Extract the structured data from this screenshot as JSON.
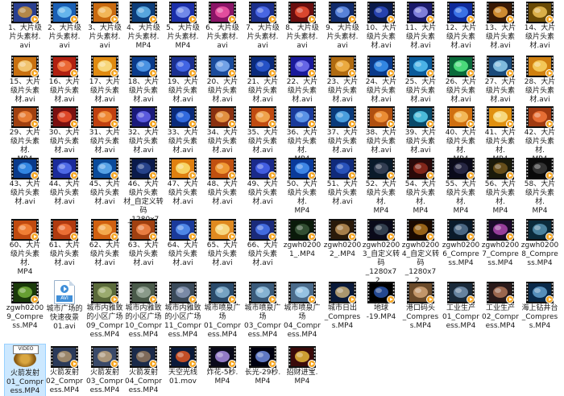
{
  "explorer": {
    "items": [
      {
        "label": "1、大片级\n片头素材.\navi",
        "thumb": "#2a3f8f",
        "thumb2": "#e0a030",
        "icon": "video-thumb-icon"
      },
      {
        "label": "2、大片级\n片头素材.\navi",
        "thumb": "#1a5fb4",
        "thumb2": "#7fd0ff",
        "icon": "video-thumb-icon"
      },
      {
        "label": "3、大片级\n片头素材.\navi",
        "thumb": "#c96a10",
        "thumb2": "#ffd070",
        "icon": "video-thumb-icon"
      },
      {
        "label": "4、大片级\n片头素材.\nMP4",
        "thumb": "#0c3d7a",
        "thumb2": "#70c8ff",
        "icon": "video-thumb-icon"
      },
      {
        "label": "5、大片级\n片头素材.\nMP4",
        "thumb": "#1b2fa8",
        "thumb2": "#8fa8ff",
        "icon": "video-thumb-icon"
      },
      {
        "label": "6、大片级\n片头素材.\navi",
        "thumb": "#8a1466",
        "thumb2": "#ff60b0",
        "icon": "video-thumb-icon"
      },
      {
        "label": "7、大片级\n片头素材.\navi",
        "thumb": "#1a2e8a",
        "thumb2": "#5a7aff",
        "icon": "video-thumb-icon"
      },
      {
        "label": "8、大片级\n片头素材.\navi",
        "thumb": "#6a0e0e",
        "thumb2": "#ff5a3a",
        "icon": "video-thumb-icon"
      },
      {
        "label": "9、大片级\n片头素材.\navi",
        "thumb": "#102a6a",
        "thumb2": "#70a0ff",
        "icon": "video-thumb-icon"
      },
      {
        "label": "10、大片\n级片头素\n材.avi",
        "thumb": "#0a1a4a",
        "thumb2": "#3050d0",
        "icon": "video-thumb-icon"
      },
      {
        "label": "11、大片\n级片头素\n材.avi",
        "thumb": "#1a1a6a",
        "thumb2": "#a0a0ff",
        "icon": "video-thumb-icon"
      },
      {
        "label": "12、大片\n级片头素\n材.avi",
        "thumb": "#0e2a9a",
        "thumb2": "#4a8aff",
        "icon": "video-thumb-icon"
      },
      {
        "label": "13、大片\n级片头素\n材.avi",
        "thumb": "#3a1a05",
        "thumb2": "#ffb040",
        "icon": "video-thumb-icon"
      },
      {
        "label": "14、大片\n级片头素\n材.avi",
        "thumb": "#6a4a05",
        "thumb2": "#ffd060",
        "icon": "video-thumb-icon"
      },
      {
        "label": "15、大片\n级片头素\n材.avi",
        "thumb": "#c87010",
        "thumb2": "#ffe090",
        "icon": "video-thumb-icon"
      },
      {
        "label": "16、大片\n级片头素\n材.avi",
        "thumb": "#b02010",
        "thumb2": "#ff8040",
        "icon": "video-thumb-icon"
      },
      {
        "label": "17、大片\n级片头素\n材.avi",
        "thumb": "#e08a10",
        "thumb2": "#fff0a0",
        "icon": "video-thumb-icon"
      },
      {
        "label": "18、大片\n级片头素\n材.avi",
        "thumb": "#0a3a8a",
        "thumb2": "#60b0ff",
        "icon": "video-thumb-icon"
      },
      {
        "label": "19、大片\n级片头素\n材.avi",
        "thumb": "#1a2f8f",
        "thumb2": "#5078ff",
        "icon": "video-thumb-icon"
      },
      {
        "label": "20、大片\n级片头素\n材.avi",
        "thumb": "#1a4a9a",
        "thumb2": "#90c0ff",
        "icon": "video-thumb-icon"
      },
      {
        "label": "21、大片\n级片头素\n材.avi",
        "thumb": "#0a2a7a",
        "thumb2": "#3060e0",
        "icon": "video-thumb-icon"
      },
      {
        "label": "22、大片\n级片头素\n材.avi",
        "thumb": "#1a1a9a",
        "thumb2": "#8080ff",
        "icon": "video-thumb-icon"
      },
      {
        "label": "23、大片\n级片头素\n材.avi",
        "thumb": "#b06a10",
        "thumb2": "#ffc050",
        "icon": "video-thumb-icon"
      },
      {
        "label": "24、大片\n级片头素\n材.avi",
        "thumb": "#0a3a8a",
        "thumb2": "#40a0ff",
        "icon": "video-thumb-icon"
      },
      {
        "label": "25、大片\n级片头素\n材.avi",
        "thumb": "#0a5a9a",
        "thumb2": "#60d0ff",
        "icon": "video-thumb-icon"
      },
      {
        "label": "26、大片\n级片头素\n材.avi",
        "thumb": "#0a6a3a",
        "thumb2": "#60ff90",
        "icon": "video-thumb-icon"
      },
      {
        "label": "27、大片\n级片头素\n材.avi",
        "thumb": "#1a4a7a",
        "thumb2": "#a0e0ff",
        "icon": "video-thumb-icon"
      },
      {
        "label": "28、大片\n级片头素\n材.avi",
        "thumb": "#d08010",
        "thumb2": "#ffe070",
        "icon": "video-thumb-icon"
      },
      {
        "label": "29、大片\n级片头素\n材.\nMP4",
        "thumb": "#a04010",
        "thumb2": "#ff9040",
        "icon": "video-thumb-icon"
      },
      {
        "label": "30、大片\n级片头素\n材.avi",
        "thumb": "#7a1010",
        "thumb2": "#ff5a30",
        "icon": "video-thumb-icon"
      },
      {
        "label": "31、大片\n级片头素\n材.avi",
        "thumb": "#c04010",
        "thumb2": "#ffa040",
        "icon": "video-thumb-icon"
      },
      {
        "label": "32、大片\n级片头素\n材.avi",
        "thumb": "#1a1a7a",
        "thumb2": "#7070ff",
        "icon": "video-thumb-icon"
      },
      {
        "label": "33、大片\n级片头素\n材.avi",
        "thumb": "#0a2a7a",
        "thumb2": "#4080ff",
        "icon": "video-thumb-icon"
      },
      {
        "label": "34、大片\n级片头素\n材.avi",
        "thumb": "#8a3010",
        "thumb2": "#ffb050",
        "icon": "video-thumb-icon"
      },
      {
        "label": "35、大片\n级片头素\n材.avi",
        "thumb": "#c04a10",
        "thumb2": "#ffc060",
        "icon": "video-thumb-icon"
      },
      {
        "label": "36、大片\n级片头素\n材.\nMP4",
        "thumb": "#1a3a9a",
        "thumb2": "#70b0ff",
        "icon": "video-thumb-icon"
      },
      {
        "label": "37、大片\n级片头素\n材.avi",
        "thumb": "#0a3a7a",
        "thumb2": "#60c0ff",
        "icon": "video-thumb-icon"
      },
      {
        "label": "38、大片\n级片头素\n材.avi",
        "thumb": "#b05010",
        "thumb2": "#ffa040",
        "icon": "video-thumb-icon"
      },
      {
        "label": "39、大片\n级片头素\n材.avi",
        "thumb": "#0a4a6a",
        "thumb2": "#60e0ff",
        "icon": "video-thumb-icon"
      },
      {
        "label": "40、大片\n级片头素\n材.\nMP4",
        "thumb": "#d07010",
        "thumb2": "#ffd070",
        "icon": "video-thumb-icon"
      },
      {
        "label": "41、大片\n级片头素\n材.\nMP4",
        "thumb": "#e09010",
        "thumb2": "#fff0a0",
        "icon": "video-thumb-icon"
      },
      {
        "label": "42、大片\n级片头素\n材.\nMP4",
        "thumb": "#a03a10",
        "thumb2": "#ff8040",
        "icon": "video-thumb-icon"
      },
      {
        "label": "43、大片\n级片头素\n材.avi",
        "thumb": "#0a3a8a",
        "thumb2": "#40a0ff",
        "icon": "video-thumb-icon"
      },
      {
        "label": "44、大片\n级片头素\n材.avi",
        "thumb": "#1a2a9a",
        "thumb2": "#6080ff",
        "icon": "video-thumb-icon"
      },
      {
        "label": "45、大片\n级片头素\n材.avi",
        "thumb": "#0a4a9a",
        "thumb2": "#70c0ff",
        "icon": "video-thumb-icon"
      },
      {
        "label": "46、大片\n级片头素\n材_自定义转码\n_1280x72...",
        "thumb": "#0a1a4a",
        "thumb2": "#3050a0",
        "icon": "video-thumb-icon"
      },
      {
        "label": "47、大片\n级片头素\n材.avi",
        "thumb": "#e08010",
        "thumb2": "#fff080",
        "icon": "video-thumb-icon"
      },
      {
        "label": "48、大片\n级片头素\n材.avi",
        "thumb": "#c05010",
        "thumb2": "#ffb040",
        "icon": "video-thumb-icon"
      },
      {
        "label": "49、大片\n级片头素\n材.avi",
        "thumb": "#1a2a8a",
        "thumb2": "#5070ff",
        "icon": "video-thumb-icon"
      },
      {
        "label": "50、大片\n级片头素\n材.\nMP4",
        "thumb": "#0a3a9a",
        "thumb2": "#50a0ff",
        "icon": "video-thumb-icon"
      },
      {
        "label": "51、大片\n级片头素\n材.avi",
        "thumb": "#102a7a",
        "thumb2": "#3060d0",
        "icon": "video-thumb-icon"
      },
      {
        "label": "52、大片\n级片头素\n材.\nMP4",
        "thumb": "#0a1a2a",
        "thumb2": "#404a60",
        "icon": "video-thumb-icon"
      },
      {
        "label": "54、大片\n级片头素\n材.\nMP4",
        "thumb": "#2a0a0a",
        "thumb2": "#a03020",
        "icon": "video-thumb-icon"
      },
      {
        "label": "55、大片\n级片头素\n材.\nMP4",
        "thumb": "#0a0a1a",
        "thumb2": "#303050",
        "icon": "video-thumb-icon"
      },
      {
        "label": "56、大片\n级片头素\n材.\nMP4",
        "thumb": "#1a1a0a",
        "thumb2": "#806020",
        "icon": "video-thumb-icon"
      },
      {
        "label": "58、大片\n级片头素\n材.\nMP4",
        "thumb": "#0a0a0a",
        "thumb2": "#404040",
        "icon": "video-thumb-icon"
      },
      {
        "label": "60、大片\n级片头素\n材.\nMP4",
        "thumb": "#c04a10",
        "thumb2": "#ff9040",
        "icon": "video-thumb-icon"
      },
      {
        "label": "61、大片\n级片头素\n材.avi",
        "thumb": "#b03a10",
        "thumb2": "#ff8040",
        "icon": "video-thumb-icon"
      },
      {
        "label": "62、大片\n级片头素\n材.avi",
        "thumb": "#d06010",
        "thumb2": "#ffc060",
        "icon": "video-thumb-icon"
      },
      {
        "label": "63、大片\n级片头素\n材.avi",
        "thumb": "#a04010",
        "thumb2": "#ff9050",
        "icon": "video-thumb-icon"
      },
      {
        "label": "64、大片\n级片头素\n材.avi",
        "thumb": "#1a3a9a",
        "thumb2": "#60a0ff",
        "icon": "video-thumb-icon"
      },
      {
        "label": "65、大片\n级片头素\n材.avi",
        "thumb": "#e08a20",
        "thumb2": "#fff0a0",
        "icon": "video-thumb-icon"
      },
      {
        "label": "66、大片\n级片头素\n材.avi",
        "thumb": "#1a2a7a",
        "thumb2": "#5080ff",
        "icon": "video-thumb-icon"
      },
      {
        "label": "zgwh0200\n1_.MP4",
        "thumb": "#0a1a0a",
        "thumb2": "#406040",
        "icon": "video-thumb-icon"
      },
      {
        "label": "zgwh0200\n2_.MP4",
        "thumb": "#2a1a0a",
        "thumb2": "#d0a060",
        "icon": "video-thumb-icon"
      },
      {
        "label": "zgwh0200\n3_自定义转\n码\n_1280x72...",
        "thumb": "#0a0a1a",
        "thumb2": "#405060",
        "icon": "video-thumb-icon"
      },
      {
        "label": "zgwh0200\n4_自定义转\n码\n_1280x72...",
        "thumb": "#1a0a00",
        "thumb2": "#c08020",
        "icon": "video-thumb-icon"
      },
      {
        "label": "zgwh0200\n6_Compre\nss.MP4",
        "thumb": "#0a1a2a",
        "thumb2": "#6080a0",
        "icon": "video-thumb-icon"
      },
      {
        "label": "zgwh0200\n7_Compre\nss.MP4",
        "thumb": "#1a0a2a",
        "thumb2": "#c050c0",
        "icon": "video-thumb-icon"
      },
      {
        "label": "zgwh0200\n8_Compre\nss.MP4",
        "thumb": "#0a2a3a",
        "thumb2": "#60a0c0",
        "icon": "video-thumb-icon"
      },
      {
        "label": "zgwh0200\n9_Compre\nss.MP4",
        "thumb": "#1a3a0a",
        "thumb2": "#80c040",
        "icon": "video-thumb-icon"
      },
      {
        "label": "城市广场的\n快速夜景\n01.avi",
        "thumb": "#ffffff",
        "thumb2": "#3f8ed8",
        "icon": "avi-file-icon"
      },
      {
        "label": "城市内雅致\n的小区广场\n09_Compr\ness.MP4",
        "thumb": "#5a6a3a",
        "thumb2": "#b0c080",
        "icon": "video-thumb-icon"
      },
      {
        "label": "城市内雅致\n的小区广场\n10_Compr\ness.MP4",
        "thumb": "#4a5a4a",
        "thumb2": "#a0b0a0",
        "icon": "video-thumb-icon"
      },
      {
        "label": "城市内雅致\n的小区广场\n11_Compr\ness.MP4",
        "thumb": "#3a4a5a",
        "thumb2": "#90a0c0",
        "icon": "video-thumb-icon"
      },
      {
        "label": "城市喷泉广\n场\n01_Compr\ness.MP4",
        "thumb": "#2a4a6a",
        "thumb2": "#90c0e0",
        "icon": "video-thumb-icon"
      },
      {
        "label": "城市喷泉广\n场\n03_Compr\ness.MP4",
        "thumb": "#3a5a7a",
        "thumb2": "#a0d0f0",
        "icon": "video-thumb-icon"
      },
      {
        "label": "城市喷泉广\n场\n04_Compr\ness.MP4",
        "thumb": "#4a6a8a",
        "thumb2": "#b0e0ff",
        "icon": "video-thumb-icon"
      },
      {
        "label": "城市日出\n_Compres\ns.MP4",
        "thumb": "#0a1a3a",
        "thumb2": "#e0c080",
        "icon": "video-thumb-icon"
      },
      {
        "label": "地球\n-19.MP4",
        "thumb": "#000000",
        "thumb2": "#3060c0",
        "icon": "video-thumb-icon"
      },
      {
        "label": "港口码头\n_Compres\ns.MP4",
        "thumb": "#6a4a2a",
        "thumb2": "#e0b080",
        "icon": "video-thumb-icon"
      },
      {
        "label": "工业生产\n01_Compr\ness.MP4",
        "thumb": "#1a2a3a",
        "thumb2": "#80a0c0",
        "icon": "video-thumb-icon"
      },
      {
        "label": "工业生产\n02_Compr\ness.MP4",
        "thumb": "#2a1a1a",
        "thumb2": "#c08060",
        "icon": "video-thumb-icon"
      },
      {
        "label": "海上钻井台\n_Compres\ns.MP4",
        "thumb": "#0a2a4a",
        "thumb2": "#70b0e0",
        "icon": "video-thumb-icon"
      },
      {
        "label": "火箭发射\n01_Compr\ness.MP4",
        "thumb": "#ffffff",
        "thumb2": "#d9a640",
        "icon": "video-file-icon"
      },
      {
        "label": "火箭发射\n02_Compr\ness.MP4",
        "thumb": "#2a3a5a",
        "thumb2": "#c0a070",
        "icon": "video-thumb-icon"
      },
      {
        "label": "火箭发射\n03_Compr\ness.MP4",
        "thumb": "#3a4a6a",
        "thumb2": "#d0b080",
        "icon": "video-thumb-icon"
      },
      {
        "label": "火箭发射\n04_Compr\ness.MP4",
        "thumb": "#1a2a4a",
        "thumb2": "#a08060",
        "icon": "video-thumb-icon"
      },
      {
        "label": "天空光线\n01.mov",
        "thumb": "#0a1a3a",
        "thumb2": "#ff6020",
        "icon": "video-thumb-icon"
      },
      {
        "label": "炸花-5秒.\nMP4",
        "thumb": "#0a0a1a",
        "thumb2": "#c0a0ff",
        "icon": "video-thumb-icon"
      },
      {
        "label": "长光-29秒.\nMP4",
        "thumb": "#000010",
        "thumb2": "#80a0ff",
        "icon": "video-thumb-icon"
      },
      {
        "label": "招财进宝.\nMP4",
        "thumb": "#3a0a0a",
        "thumb2": "#ffd040",
        "icon": "video-thumb-icon"
      }
    ]
  }
}
